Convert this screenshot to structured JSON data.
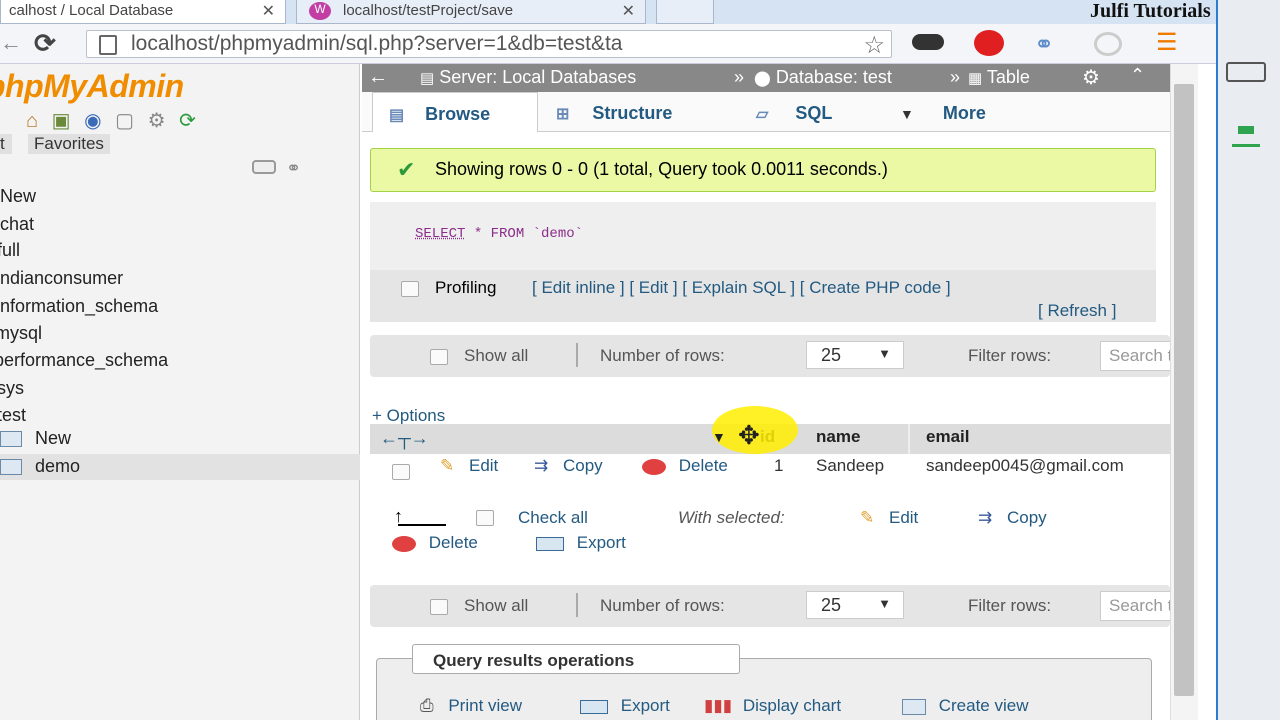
{
  "browser": {
    "tabs": [
      {
        "title": "calhost / Local Database"
      },
      {
        "title": "localhost/testProject/save"
      }
    ],
    "url": "localhost/phpmyadmin/sql.php?server=1&db=test&ta",
    "watermark": "Julfi Tutorials"
  },
  "sidebar": {
    "logo": "phpMyAdmin",
    "tabs": [
      "t",
      "Favorites"
    ],
    "items": [
      "New",
      "chat",
      "full",
      "indianconsumer",
      "information_schema",
      "mysql",
      "performance_schema",
      "sys",
      "test"
    ],
    "sub_items": [
      "New",
      "demo"
    ]
  },
  "breadcrumb": {
    "server": "Server: Local Databases",
    "sep1": "»",
    "database": "Database: test",
    "sep2": "»",
    "table": "Table"
  },
  "tabs": {
    "browse": "Browse",
    "structure": "Structure",
    "sql": "SQL",
    "more": "More"
  },
  "message": "Showing rows 0 - 0 (1 total, Query took 0.0011 seconds.)",
  "sql": {
    "keyword1": "SELECT",
    "rest": " * FROM `demo`"
  },
  "profiling": {
    "label": "Profiling",
    "links": [
      "Edit inline",
      "Edit",
      "Explain SQL",
      "Create PHP code",
      "Refresh"
    ]
  },
  "nav": {
    "show_all": "Show all",
    "rows_label": "Number of rows:",
    "rows_value": "25",
    "filter_label": "Filter rows:",
    "filter_placeholder": "Search this table"
  },
  "options_link": "+ Options",
  "columns": [
    "id",
    "name",
    "email"
  ],
  "row": {
    "edit": "Edit",
    "copy": "Copy",
    "delete": "Delete",
    "id": "1",
    "name": "Sandeep",
    "email": "sandeep0045@gmail.com"
  },
  "bulk": {
    "check_all": "Check all",
    "with_selected": "With selected:",
    "edit": "Edit",
    "copy": "Copy",
    "delete": "Delete",
    "export": "Export"
  },
  "query_ops": {
    "title": "Query results operations",
    "print": "Print view",
    "export": "Export",
    "chart": "Display chart",
    "view": "Create view"
  },
  "colors": {
    "accent": "#235a81",
    "logo": "#f08c00",
    "success_bg": "#ebf8a4",
    "cursor_highlight": "#ffee00"
  }
}
